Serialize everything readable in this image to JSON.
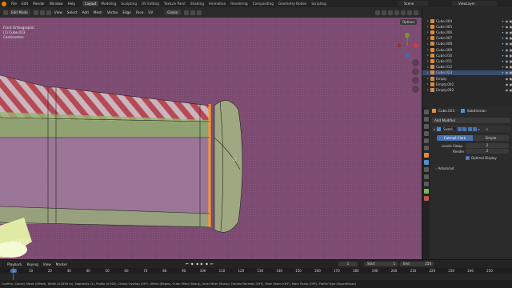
{
  "topbar": {
    "menus": [
      "File",
      "Edit",
      "Render",
      "Window",
      "Help"
    ],
    "workspaces": [
      "Layout",
      "Modeling",
      "Sculpting",
      "UV Editing",
      "Texture Paint",
      "Shading",
      "Animation",
      "Rendering",
      "Compositing",
      "Geometry Nodes",
      "Scripting"
    ],
    "active_workspace": "Layout",
    "scene": "Scene",
    "view_layer": "ViewLayer"
  },
  "viewport_header": {
    "mode": "Edit Mode",
    "menus": [
      "View",
      "Select",
      "Add",
      "Mesh",
      "Vertex",
      "Edge",
      "Face",
      "UV"
    ],
    "orientation": "Global",
    "options": "Options"
  },
  "viewport": {
    "view_name": "Front Orthographic",
    "object_line": "(1) Cube.023",
    "units": "Centimeters",
    "hotkey_overlay": "OSKEY",
    "background_color": "#7d4b71"
  },
  "outliner": {
    "rows": [
      {
        "label": "Cube.004",
        "selected": false
      },
      {
        "label": "Cube.005",
        "selected": false
      },
      {
        "label": "Cube.006",
        "selected": false
      },
      {
        "label": "Cube.007",
        "selected": false
      },
      {
        "label": "Cube.008",
        "selected": false
      },
      {
        "label": "Cube.009",
        "selected": false
      },
      {
        "label": "Cube.010",
        "selected": false
      },
      {
        "label": "Cube.011",
        "selected": false
      },
      {
        "label": "Cube.012",
        "selected": false
      },
      {
        "label": "Cube.023",
        "selected": true
      },
      {
        "label": "Empty",
        "selected": false
      },
      {
        "label": "Empty.001",
        "selected": false
      },
      {
        "label": "Empty.002",
        "selected": false
      }
    ]
  },
  "properties": {
    "object_name": "Cube.023",
    "modifier_tab": "Subdivision",
    "add_modifier": "Add Modifier",
    "modifier_name": "Subdi...",
    "catmull": "Catmull-Clark",
    "simple": "Simple",
    "levels_viewport_label": "Levels Viewp.",
    "levels_viewport_value": "2",
    "render_label": "Render",
    "render_value": "2",
    "optimal_display": "Optimal Display",
    "advanced": "Advanced"
  },
  "timeline": {
    "menus": [
      "Playback",
      "Keying",
      "View",
      "Marker"
    ],
    "current_frame": "1",
    "start_label": "Start",
    "start_value": "1",
    "end_label": "End",
    "end_value": "250",
    "ruler_ticks": [
      "1",
      "10",
      "20",
      "30",
      "40",
      "50",
      "60",
      "70",
      "80",
      "90",
      "100",
      "110",
      "120",
      "130",
      "140",
      "150",
      "160",
      "170",
      "180",
      "190",
      "200",
      "210",
      "220",
      "230",
      "240",
      "250"
    ]
  },
  "statusbar": {
    "text": "Confirm, Cancel, Mode (Offset), Width (0.0494 m), Segments (2), Profile (0.500), Clamp Overlap (OFF), Affect (Edges), Outer Miter (Sharp), Inner Miter (Sharp), Harden Normals (OFF), Mark Seam (OFF), Mark Sharp (OFF), Profile Type (Superellipse)"
  },
  "colors": {
    "accent": "#4772b3",
    "selected_row": "#3b4d6d",
    "highlight_edge": "#ff9b2a"
  }
}
